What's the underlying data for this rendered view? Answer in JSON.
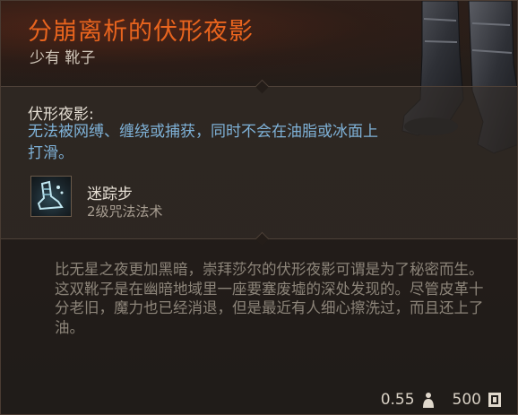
{
  "item": {
    "name": "分崩离析的伏形夜影",
    "rarity_type": "少有 靴子",
    "name_color": "#e8641e"
  },
  "property": {
    "title": "伏形夜影:",
    "description": "无法被网缚、缠绕或捕获，同时不会在油脂或冰面上打滑。",
    "description_color": "#7fb2d8"
  },
  "spell": {
    "name": "迷踪步",
    "level": "2级咒法法术",
    "icon": "footstep-spell-icon"
  },
  "lore": {
    "paragraph1": "比无星之夜更加黑暗，崇拜莎尔的伏形夜影可谓是为了秘密而生。",
    "paragraph2": "这双靴子是在幽暗地域里一座要塞废墟的深处发现的。尽管皮革十分老旧，魔力也已经消退，但是最近有人细心擦洗过，而且还上了油。"
  },
  "footer": {
    "weight": "0.55",
    "weight_icon": "weight-icon",
    "value": "500",
    "value_icon": "gold-icon"
  }
}
